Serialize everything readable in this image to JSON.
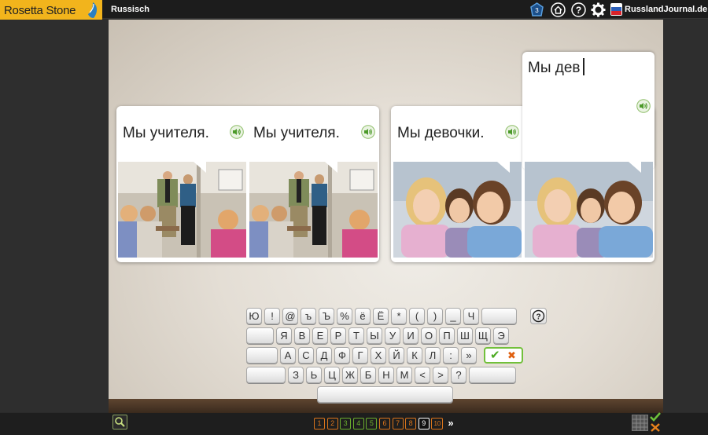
{
  "app": {
    "logo": "Rosetta Stone",
    "course_title": "Russisch",
    "account_label": "RusslandJournal.de",
    "toolbar_icons": [
      "lesson-badge-icon",
      "home-icon",
      "help-icon",
      "gear-icon"
    ]
  },
  "cards": [
    {
      "phrase": "Мы учителя.",
      "image": "teachers-photo"
    },
    {
      "phrase": "Мы учителя.",
      "image": "teachers-photo"
    },
    {
      "phrase": "Мы девочки.",
      "image": "girls-photo"
    },
    {
      "phrase": "Мы дев",
      "image": "girls-photo",
      "is_input": true
    }
  ],
  "keyboard": {
    "rows": [
      [
        "Ю",
        "!",
        "@",
        "ъ",
        "Ъ",
        "%",
        "ё",
        "Ё",
        "*",
        "(",
        ")",
        "_",
        "Ч",
        ""
      ],
      [
        "",
        "Я",
        "В",
        "Е",
        "Р",
        "Т",
        "Ы",
        "У",
        "И",
        "О",
        "П",
        "Ш",
        "Щ",
        "Э"
      ],
      [
        "",
        "А",
        "С",
        "Д",
        "Ф",
        "Г",
        "Х",
        "Й",
        "К",
        "Л",
        ":",
        "»"
      ],
      [
        "",
        "З",
        "Ь",
        "Ц",
        "Ж",
        "Б",
        "Н",
        "М",
        "<",
        ">",
        "?",
        ""
      ]
    ],
    "help_label": "?",
    "check_symbols": [
      "✔",
      "✖"
    ]
  },
  "pagination": {
    "pages": [
      "1",
      "2",
      "3",
      "4",
      "5",
      "6",
      "7",
      "8",
      "9",
      "10"
    ],
    "current": "9",
    "next_label": "»",
    "colors": [
      "#d8741c",
      "#d8741c",
      "#6aad2e",
      "#6aad2e",
      "#6aad2e",
      "#d8741c",
      "#d8741c",
      "#d8741c",
      "#ffffff",
      "#d8741c"
    ]
  },
  "colors": {
    "brand": "#f2b41c",
    "correct": "#72c03b",
    "incorrect": "#e06010"
  }
}
